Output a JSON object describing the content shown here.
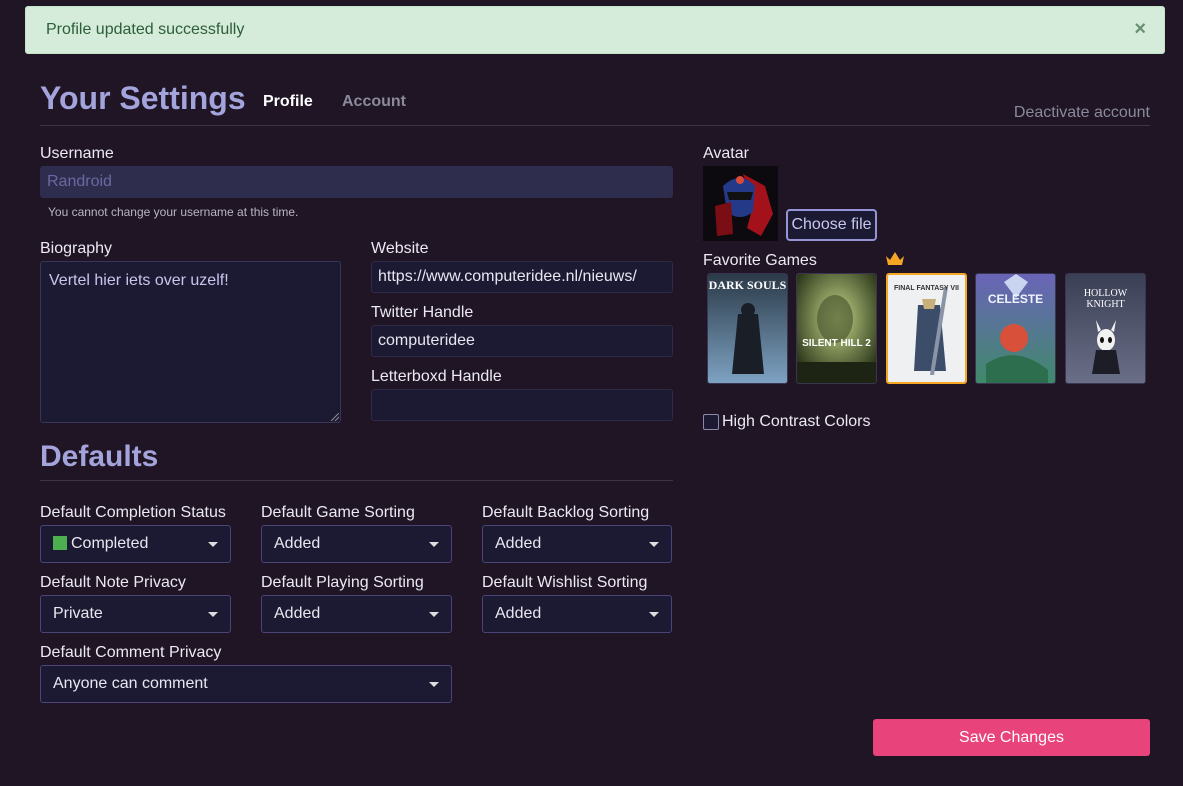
{
  "flash": {
    "message": "Profile updated successfully",
    "close": "×"
  },
  "header": {
    "title": "Your Settings",
    "tabs": [
      "Profile",
      "Account"
    ],
    "deactivate": "Deactivate account"
  },
  "profile": {
    "username_label": "Username",
    "username_value": "Randroid",
    "username_hint": "You cannot change your username at this time.",
    "biography_label": "Biography",
    "biography_placeholder": "Vertel hier iets over uzelf!",
    "website_label": "Website",
    "website_value": "https://www.computeridee.nl/nieuws/",
    "twitter_label": "Twitter Handle",
    "twitter_value": "computeridee",
    "letterboxd_label": "Letterboxd Handle",
    "letterboxd_value": "",
    "avatar_label": "Avatar",
    "choose_file": "Choose file",
    "favorite_games_label": "Favorite Games",
    "favorite_games": [
      "DARK SOULS",
      "SILENT HILL 2",
      "FINAL FANTASY VII",
      "CELESTE",
      "HOLLOW KNIGHT"
    ],
    "high_contrast_label": "High Contrast Colors"
  },
  "defaults": {
    "title": "Defaults",
    "completion_status": {
      "label": "Default Completion Status",
      "value": "Completed"
    },
    "game_sorting": {
      "label": "Default Game Sorting",
      "value": "Added"
    },
    "backlog_sorting": {
      "label": "Default Backlog Sorting",
      "value": "Added"
    },
    "note_privacy": {
      "label": "Default Note Privacy",
      "value": "Private"
    },
    "playing_sorting": {
      "label": "Default Playing Sorting",
      "value": "Added"
    },
    "wishlist_sorting": {
      "label": "Default Wishlist Sorting",
      "value": "Added"
    },
    "comment_privacy": {
      "label": "Default Comment Privacy",
      "value": "Anyone can comment"
    }
  },
  "save_button": "Save Changes",
  "colors": {
    "accent": "#a4a4dc",
    "save": "#e8437a",
    "completed": "#4caf50",
    "favorite": "#f5a623"
  }
}
